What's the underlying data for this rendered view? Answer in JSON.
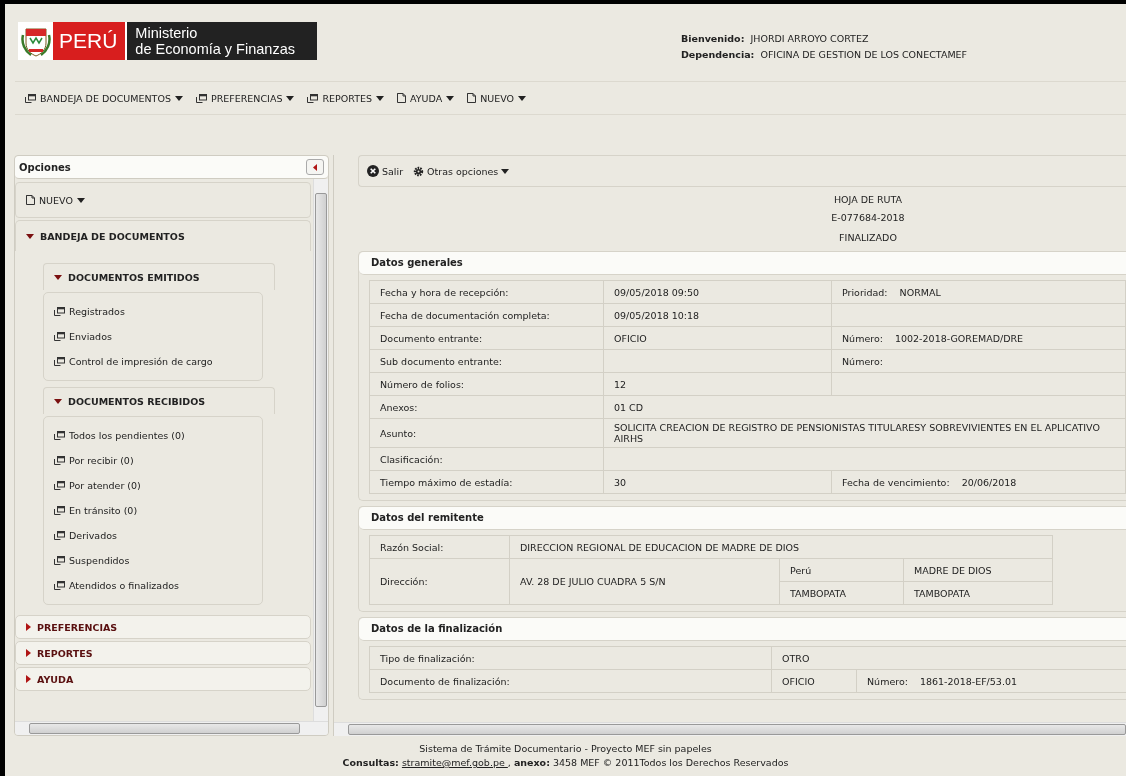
{
  "header": {
    "logo": {
      "brand": "PERÚ",
      "name_line1": "Ministerio",
      "name_line2": "de Economía y Finanzas"
    },
    "user": [
      {
        "label": "Bienvenido:",
        "value": "JHORDI ARROYO CORTEZ"
      },
      {
        "label": "Dependencia:",
        "value": "OFICINA DE GESTION DE LOS CONECTAMEF"
      }
    ]
  },
  "menu": [
    {
      "label": "BANDEJA DE DOCUMENTOS",
      "kind": "window"
    },
    {
      "label": "PREFERENCIAS",
      "kind": "window"
    },
    {
      "label": "REPORTES",
      "kind": "window"
    },
    {
      "label": "AYUDA",
      "kind": "document"
    },
    {
      "label": "NUEVO",
      "kind": "document"
    }
  ],
  "sidebar": {
    "title": "Opciones",
    "items": [
      {
        "kind": "dropdown",
        "label": "NUEVO"
      },
      {
        "kind": "section",
        "label": "BANDEJA DE DOCUMENTOS",
        "expanded": true,
        "children": [
          {
            "label": "DOCUMENTOS EMITIDOS",
            "expanded": true,
            "children": [
              {
                "label": "Registrados"
              },
              {
                "label": "Enviados"
              },
              {
                "label": "Control de impresión de cargo"
              }
            ]
          },
          {
            "label": "DOCUMENTOS RECIBIDOS",
            "expanded": true,
            "children": [
              {
                "label": "Todos los pendientes (0)"
              },
              {
                "label": "Por recibir (0)"
              },
              {
                "label": "Por atender (0)"
              },
              {
                "label": "En tránsito (0)"
              },
              {
                "label": "Derivados"
              },
              {
                "label": "Suspendidos"
              },
              {
                "label": "Atendidos o finalizados"
              }
            ]
          }
        ]
      },
      {
        "kind": "section",
        "label": "PREFERENCIAS",
        "expanded": false
      },
      {
        "kind": "section",
        "label": "REPORTES",
        "expanded": false
      },
      {
        "kind": "section",
        "label": "AYUDA",
        "expanded": false
      }
    ]
  },
  "toolbar": [
    {
      "label": "Salir",
      "kind": "exit",
      "dropdown": false
    },
    {
      "label": "Otras opciones",
      "kind": "options",
      "dropdown": true
    }
  ],
  "document": {
    "type": "HOJA DE RUTA",
    "code": "E-077684-2018",
    "status": "FINALIZADO"
  },
  "sections": [
    {
      "title": "Datos generales",
      "kind": "general",
      "rows": [
        [
          {
            "kind": "cell",
            "text": "Fecha y hora de recepción:"
          },
          {
            "kind": "cell",
            "text": "09/05/2018 09:50"
          },
          {
            "kind": "pair",
            "label": "Prioridad:",
            "value": "NORMAL"
          }
        ],
        [
          {
            "kind": "cell",
            "text": "Fecha de documentación completa:"
          },
          {
            "kind": "cell",
            "text": "09/05/2018 10:18"
          },
          {
            "kind": "blank"
          }
        ],
        [
          {
            "kind": "cell",
            "text": "Documento entrante:"
          },
          {
            "kind": "cell",
            "text": "OFICIO"
          },
          {
            "kind": "pair",
            "label": "Número:",
            "value": "1002-2018-GOREMAD/DRE"
          }
        ],
        [
          {
            "kind": "cell",
            "text": "Sub documento entrante:"
          },
          {
            "kind": "blank"
          },
          {
            "kind": "pair",
            "label": "Número:"
          }
        ],
        [
          {
            "kind": "cell",
            "text": "Número de folios:"
          },
          {
            "kind": "cell",
            "text": "12"
          },
          {
            "kind": "blank"
          }
        ],
        [
          {
            "kind": "cell",
            "text": "Anexos:"
          },
          {
            "kind": "wide",
            "colspan": 2,
            "text": "01 CD"
          }
        ],
        [
          {
            "kind": "cell",
            "text": "Asunto:"
          },
          {
            "kind": "wide",
            "colspan": 2,
            "text": "SOLICITA CREACION DE REGISTRO DE PENSIONISTAS TITULARESY SOBREVIVIENTES EN EL APLICATIVO AIRHS"
          }
        ],
        [
          {
            "kind": "cell",
            "text": "Clasificación:"
          },
          {
            "kind": "wide",
            "colspan": 2
          }
        ],
        [
          {
            "kind": "cell",
            "text": "Tiempo máximo de estadía:"
          },
          {
            "kind": "cell",
            "text": "30"
          },
          {
            "kind": "pair",
            "label": "Fecha de vencimiento:",
            "value": "20/06/2018"
          }
        ]
      ]
    },
    {
      "title": "Datos del remitente",
      "kind": "sender",
      "rows": [
        [
          {
            "kind": "cell",
            "text": "Razón Social:"
          },
          {
            "kind": "wide",
            "colspan": 3,
            "text": "DIRECCION REGIONAL DE EDUCACION DE MADRE DE DIOS"
          }
        ],
        [
          {
            "kind": "tall",
            "rowspan": 2,
            "text": "Dirección:"
          },
          {
            "kind": "tall",
            "rowspan": 2,
            "text": "AV. 28 DE JULIO CUADRA 5 S/N"
          },
          {
            "kind": "cell",
            "text": "Perú"
          },
          {
            "kind": "cell",
            "text": "MADRE DE DIOS"
          }
        ],
        [
          {
            "kind": "cell",
            "text": "TAMBOPATA"
          },
          {
            "kind": "cell",
            "text": "TAMBOPATA"
          }
        ]
      ]
    },
    {
      "title": "Datos de la finalización",
      "kind": "closing",
      "rows": [
        [
          {
            "kind": "cell",
            "text": "Tipo de finalización:"
          },
          {
            "kind": "wide",
            "colspan": 2,
            "text": "OTRO"
          }
        ],
        [
          {
            "kind": "cell",
            "text": "Documento de finalización:"
          },
          {
            "kind": "cell",
            "text": "OFICIO"
          },
          {
            "kind": "pair",
            "label": "Número:",
            "value": "1861-2018-EF/53.01"
          }
        ]
      ]
    }
  ],
  "footer": {
    "line1": "Sistema de Trámite Documentario - Proyecto MEF sin papeles",
    "before_link": "**Consultas:** ",
    "link": "stramite@mef.gob.pe ",
    "after_link": ", **anexo:** 3458 MEF © 2011Todos los Derechos Reservados"
  }
}
